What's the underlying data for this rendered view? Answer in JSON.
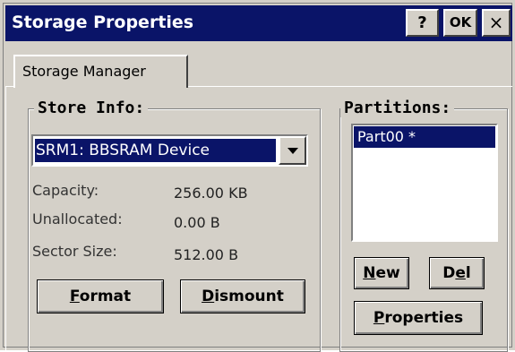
{
  "window": {
    "title": "Storage Properties",
    "help_label": "?",
    "ok_label": "OK",
    "close_label": "×"
  },
  "tabs": [
    {
      "label": "Storage Manager",
      "selected": true
    }
  ],
  "store_info": {
    "legend": "Store Info:",
    "selected_store": "SRM1: BBSRAM Device",
    "rows": [
      {
        "label": "Capacity:",
        "value": "256.00 KB"
      },
      {
        "label": "Unallocated:",
        "value": "0.00 B"
      },
      {
        "label": "Sector Size:",
        "value": "512.00 B"
      }
    ],
    "format": {
      "mnemonic": "F",
      "rest": "ormat"
    },
    "dismount": {
      "mnemonic": "D",
      "rest": "ismount"
    }
  },
  "partitions": {
    "legend": "Partitions:",
    "items": [
      {
        "label": "Part00 *",
        "selected": true
      }
    ],
    "new": {
      "mnemonic": "N",
      "rest": "ew"
    },
    "del": {
      "pre": "D",
      "mnemonic": "e",
      "rest": "l"
    },
    "properties": {
      "mnemonic": "P",
      "rest": "roperties"
    }
  },
  "colors": {
    "title_bar": "#0a1468",
    "selection": "#0a1468",
    "face": "#d4d0c8"
  }
}
